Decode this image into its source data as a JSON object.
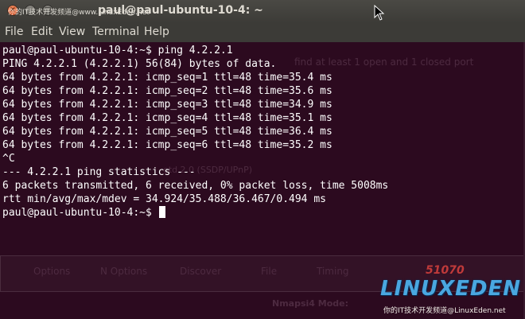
{
  "window": {
    "title": "paul@paul-ubuntu-10-4: ~",
    "watermark_top": "你的IT技术开发频道@www.LinuxEden.net"
  },
  "menu": [
    "File",
    "Edit",
    "View",
    "Terminal",
    "Help"
  ],
  "terminal": {
    "lines": [
      "paul@paul-ubuntu-10-4:~$ ping 4.2.2.1",
      "PING 4.2.2.1 (4.2.2.1) 56(84) bytes of data.",
      "64 bytes from 4.2.2.1: icmp_seq=1 ttl=48 time=35.4 ms",
      "64 bytes from 4.2.2.1: icmp_seq=2 ttl=48 time=35.6 ms",
      "64 bytes from 4.2.2.1: icmp_seq=3 ttl=48 time=34.9 ms",
      "64 bytes from 4.2.2.1: icmp_seq=4 ttl=48 time=35.1 ms",
      "64 bytes from 4.2.2.1: icmp_seq=5 ttl=48 time=36.4 ms",
      "64 bytes from 4.2.2.1: icmp_seq=6 ttl=48 time=35.2 ms",
      "^C",
      "--- 4.2.2.1 ping statistics ---",
      "6 packets transmitted, 6 received, 0% packet loss, time 5008ms",
      "rtt min/avg/max/mdev = 34.924/35.488/36.467/0.494 ms"
    ],
    "prompt": "paul@paul-ubuntu-10-4:~$ ",
    "background_color": "#2c0a1f",
    "text_color": "#ffffff"
  },
  "background_ghost": {
    "hint_text": "find at least 1 open and 1 closed port",
    "upnp_text": "etd 2.0 (SSDP/UPnP)",
    "tabs": [
      "Options",
      "N Options",
      "Discover",
      "File",
      "Timing"
    ],
    "mode_text": "Nmapsi4 Mode:"
  },
  "logo": {
    "brand": "LINUXEDEN",
    "number": "51070",
    "watermark_bottom": "你的IT技术开发频道@LinuxEden.net"
  }
}
